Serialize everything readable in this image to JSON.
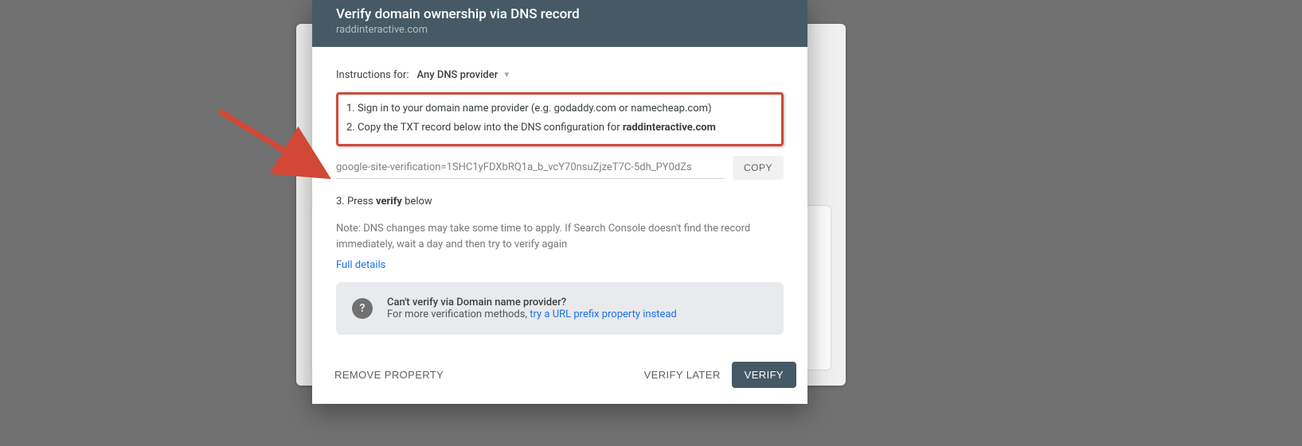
{
  "header": {
    "title": "Verify domain ownership via DNS record",
    "domain": "raddinteractive.com"
  },
  "instructions": {
    "label": "Instructions for:",
    "dropdown": "Any DNS provider",
    "step1": "1. Sign in to your domain name provider (e.g. godaddy.com or namecheap.com)",
    "step2_prefix": "2. Copy the TXT record below into the DNS configuration for ",
    "step2_domain": "raddinteractive.com",
    "txt_record": "google-site-verification=1SHC1yFDXbRQ1a_b_vcY70nsuZjzeT7C-5dh_PY0dZs",
    "copy_label": "COPY",
    "step3_prefix": "3. Press ",
    "step3_bold": "verify",
    "step3_suffix": " below",
    "note": "Note: DNS changes may take some time to apply. If Search Console doesn't find the record immediately, wait a day and then try to verify again",
    "full_details": "Full details"
  },
  "alt": {
    "title": "Can't verify via Domain name provider?",
    "sub_prefix": "For more verification methods, ",
    "sub_link": "try a URL prefix property instead"
  },
  "footer": {
    "remove": "REMOVE PROPERTY",
    "later": "VERIFY LATER",
    "verify": "VERIFY"
  }
}
